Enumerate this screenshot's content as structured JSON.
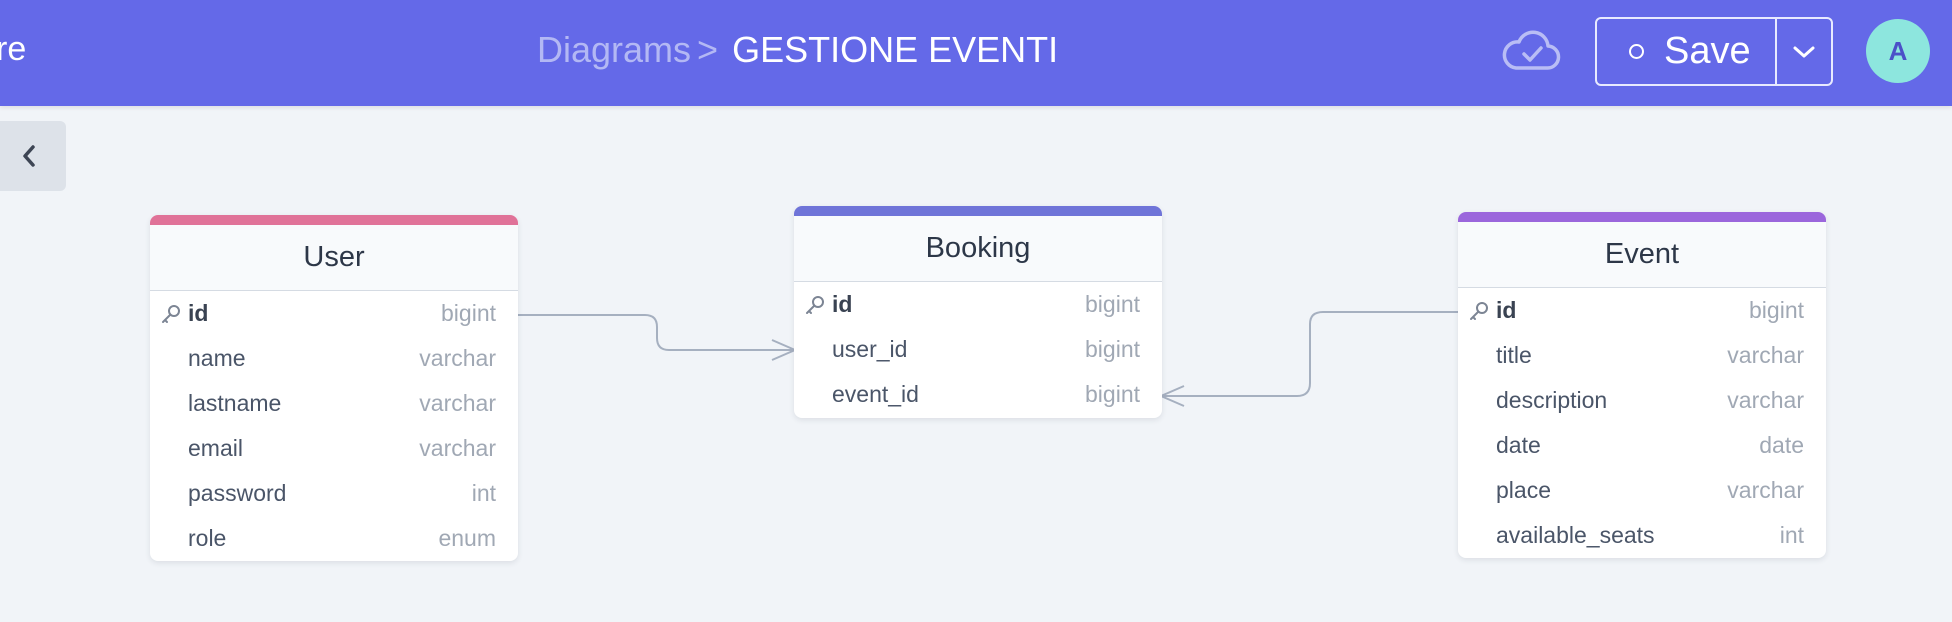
{
  "header": {
    "left_cutoff_text": "re",
    "breadcrumb_prefix": "Diagrams",
    "breadcrumb_separator": ">",
    "diagram_title": "GESTIONE EVENTI",
    "save_label": "Save",
    "avatar_initial": "A"
  },
  "colors": {
    "header_bg": "#6469e8",
    "user_accent": "#e07298",
    "booking_accent": "#6f74d8",
    "event_accent": "#9b66dc",
    "connector": "#a6b0c0"
  },
  "icons": {
    "sync": "cloud-check-icon",
    "dropdown": "chevron-down-icon",
    "collapse": "chevron-left-icon",
    "primary_key": "key-icon"
  },
  "tables": {
    "user": {
      "name": "User",
      "columns": [
        {
          "name": "id",
          "type": "bigint",
          "pk": true
        },
        {
          "name": "name",
          "type": "varchar"
        },
        {
          "name": "lastname",
          "type": "varchar"
        },
        {
          "name": "email",
          "type": "varchar"
        },
        {
          "name": "password",
          "type": "int"
        },
        {
          "name": "role",
          "type": "enum"
        }
      ]
    },
    "booking": {
      "name": "Booking",
      "columns": [
        {
          "name": "id",
          "type": "bigint",
          "pk": true
        },
        {
          "name": "user_id",
          "type": "bigint"
        },
        {
          "name": "event_id",
          "type": "bigint"
        }
      ]
    },
    "event": {
      "name": "Event",
      "columns": [
        {
          "name": "id",
          "type": "bigint",
          "pk": true
        },
        {
          "name": "title",
          "type": "varchar"
        },
        {
          "name": "description",
          "type": "varchar"
        },
        {
          "name": "date",
          "type": "date"
        },
        {
          "name": "place",
          "type": "varchar"
        },
        {
          "name": "available_seats",
          "type": "int"
        }
      ]
    }
  }
}
